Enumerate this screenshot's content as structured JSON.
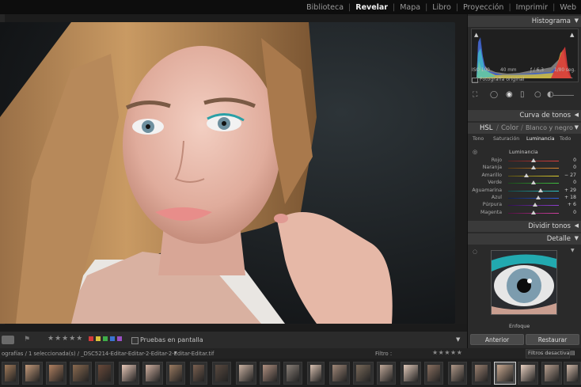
{
  "modules": {
    "items": [
      {
        "label": "Biblioteca",
        "active": false
      },
      {
        "label": "Revelar",
        "active": true
      },
      {
        "label": "Mapa",
        "active": false
      },
      {
        "label": "Libro",
        "active": false
      },
      {
        "label": "Proyección",
        "active": false
      },
      {
        "label": "Imprimir",
        "active": false
      },
      {
        "label": "Web",
        "active": false
      }
    ]
  },
  "histogram": {
    "title": "Histograma",
    "iso": "ISO 100",
    "focal": "40 mm",
    "aperture": "ƒ / 6,3",
    "shutter": "1/80 seg.",
    "original_label": "Fotografía original"
  },
  "panels": {
    "tone_curve": "Curva de tonos",
    "hsl_tabs": [
      "HSL",
      "Color",
      "Blanco y negro"
    ],
    "sub_tabs": [
      "Tono",
      "Saturación",
      "Luminancia",
      "Todo"
    ],
    "active_sub_tab": "Luminancia",
    "section_title": "Luminancia",
    "split_toning": "Dividir tonos",
    "detail": "Detalle",
    "sharpening": "Enfoque"
  },
  "luminance": [
    {
      "label": "Rojo",
      "value": "0",
      "level": 0
    },
    {
      "label": "Naranja",
      "value": "0",
      "level": 0
    },
    {
      "label": "Amarillo",
      "value": "− 27",
      "level": -27
    },
    {
      "label": "Verde",
      "value": "0",
      "level": 0
    },
    {
      "label": "Aguamarina",
      "value": "+ 29",
      "level": 29
    },
    {
      "label": "Azul",
      "value": "+ 18",
      "level": 18
    },
    {
      "label": "Púrpura",
      "value": "+ 6",
      "level": 6
    },
    {
      "label": "Magenta",
      "value": "0",
      "level": 0
    }
  ],
  "buttons": {
    "previous": "Anterior",
    "reset": "Restaurar"
  },
  "toolbar": {
    "stars": "★★★★★",
    "flag_colors": [
      "#d23a3a",
      "#d9c23a",
      "#3fae49",
      "#3a74d2",
      "#9a4fc4"
    ],
    "proof_label": "Pruebas en pantalla"
  },
  "filmbar": {
    "count_text": "ografías / 1 seleccionada(s) / _DSC5214-Editar-Editar-2-Editar-2-Editar-Editar.tif",
    "filter_label": "Filtro :",
    "filter_stars": "★★★★★",
    "filter_value": "Filtros desactiva..."
  },
  "colors": {
    "accent_active": "#f0f0f0",
    "panel_bg": "#2a2a2a",
    "header_bg": "#3a3a3a"
  }
}
